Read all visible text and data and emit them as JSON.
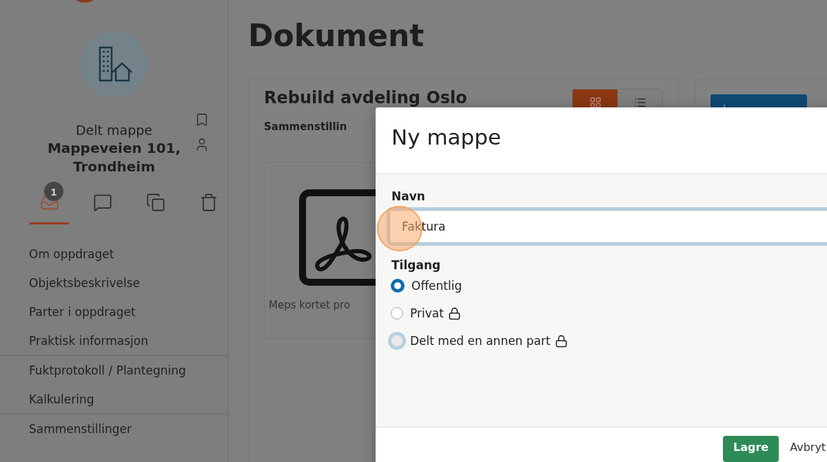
{
  "sidebar": {
    "caption": "Delt mappe",
    "address_lines": [
      "Mappeveien 101,",
      "Trondheim"
    ],
    "tabs": [
      {
        "kind": "inbox",
        "selected": true,
        "badge": "1"
      },
      {
        "kind": "comment",
        "selected": false
      },
      {
        "kind": "copies",
        "selected": false
      },
      {
        "kind": "trash",
        "selected": false
      }
    ],
    "menu_groups": [
      [
        "Om oppdraget",
        "Objektsbeskrivelse",
        "Parter i oppdraget",
        "Praktisk informasjon"
      ],
      [
        "Fuktprotokoll / Plantegning",
        "Kalkulering"
      ],
      [
        "Sammenstillinger"
      ]
    ]
  },
  "page": {
    "title": "Dokument",
    "card": {
      "title": "Rebuild avdeling Oslo",
      "subtitle": "Sammenstillin",
      "view_toggle": [
        {
          "kind": "grid",
          "selected": true
        },
        {
          "kind": "list",
          "selected": false
        }
      ],
      "document_caption": "Meps kortet pro"
    }
  },
  "modal": {
    "title": "Ny mappe",
    "name_field": {
      "label": "Navn",
      "value": "Faktura",
      "focused": true
    },
    "access": {
      "label": "Tilgang",
      "options": [
        {
          "label": "Offentlig",
          "selected": true,
          "locked": false,
          "focused": false
        },
        {
          "label": "Privat",
          "selected": false,
          "locked": true,
          "focused": false
        },
        {
          "label": "Delt med en annen part",
          "selected": false,
          "locked": true,
          "focused": true
        }
      ]
    },
    "buttons": [
      {
        "label": "Lagre",
        "kind": "primary"
      },
      {
        "label": "Avbryt",
        "kind": "link"
      }
    ]
  }
}
